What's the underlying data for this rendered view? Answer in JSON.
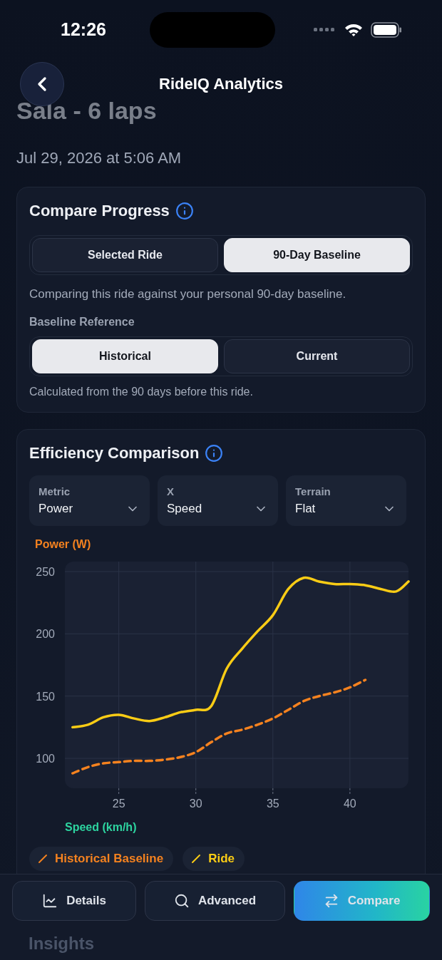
{
  "status_bar": {
    "time": "12:26"
  },
  "nav": {
    "title": "RideIQ Analytics"
  },
  "ride": {
    "title": "Sala - 6 laps",
    "date": "Jul 29, 2026 at 5:06 AM"
  },
  "compare_card": {
    "title": "Compare Progress",
    "modes": [
      {
        "label": "Selected Ride",
        "selected": false
      },
      {
        "label": "90-Day Baseline",
        "selected": true
      }
    ],
    "description": "Comparing this ride against your personal 90-day baseline.",
    "reference_label": "Baseline Reference",
    "references": [
      {
        "label": "Historical",
        "selected": true
      },
      {
        "label": "Current",
        "selected": false
      }
    ],
    "reference_note": "Calculated from the 90 days before this ride."
  },
  "efficiency_card": {
    "title": "Efficiency Comparison",
    "dropdowns": [
      {
        "label": "Metric",
        "value": "Power"
      },
      {
        "label": "X",
        "value": "Speed"
      },
      {
        "label": "Terrain",
        "value": "Flat"
      }
    ],
    "chart_data": {
      "type": "line",
      "ylabel": "Power (W)",
      "xlabel": "Speed (km/h)",
      "grid": true,
      "x": [
        22,
        23,
        24,
        25,
        26,
        27,
        28,
        29,
        30,
        31,
        32,
        33,
        34,
        35,
        36,
        37,
        38,
        39,
        40,
        41,
        42,
        43,
        43.8
      ],
      "xlim": [
        21.5,
        43.8
      ],
      "ylim": [
        76,
        258
      ],
      "xticks": [
        25,
        30,
        35,
        40
      ],
      "yticks": [
        100,
        150,
        200,
        250
      ],
      "series": [
        {
          "name": "Historical Baseline",
          "color": "#f5821f",
          "line_style": "dashed",
          "values": [
            88,
            93,
            96,
            97,
            98,
            98,
            99,
            101,
            105,
            113,
            120,
            123,
            127,
            132,
            139,
            146,
            150,
            153,
            157,
            163,
            null,
            null,
            null
          ]
        },
        {
          "name": "Ride",
          "color": "#facc15",
          "line_style": "solid",
          "values": [
            125,
            127,
            133,
            135,
            132,
            130,
            133,
            137,
            139,
            142,
            172,
            188,
            202,
            215,
            236,
            245,
            242,
            240,
            240,
            239,
            236,
            234,
            242
          ]
        }
      ]
    }
  },
  "actions": [
    {
      "label": "Details",
      "kind": "chart",
      "selected": false
    },
    {
      "label": "Advanced",
      "kind": "search",
      "selected": false
    },
    {
      "label": "Compare",
      "kind": "swap",
      "selected": true
    }
  ],
  "next_section": {
    "title": "Insights"
  }
}
